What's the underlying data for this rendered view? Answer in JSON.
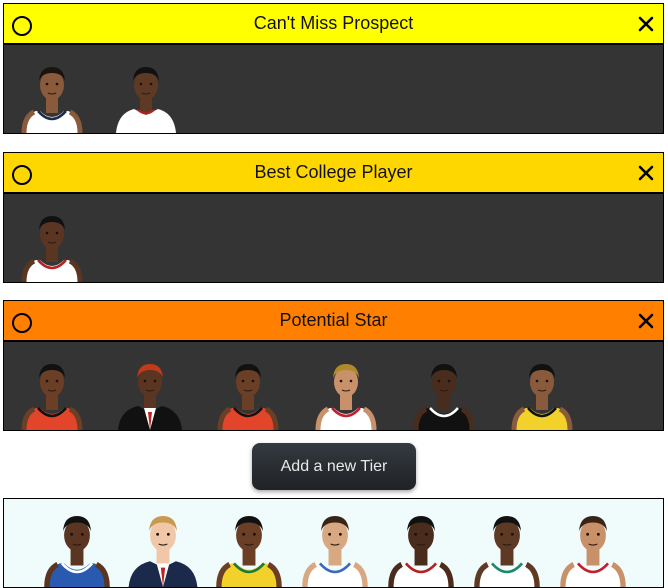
{
  "tiers": [
    {
      "title": "Can't Miss Prospect",
      "color": "#ffff00",
      "players": [
        {
          "skin": "#8a5a3c",
          "hair": "#1a1410",
          "jersey": "#ffffff",
          "trim": "#1b2a4a",
          "style": "tank"
        },
        {
          "skin": "#5e3a24",
          "hair": "#111111",
          "jersey": "#ffffff",
          "trim": "#b52020",
          "style": "tee"
        }
      ]
    },
    {
      "title": "Best College Player",
      "color": "#ffd700",
      "players": [
        {
          "skin": "#5a3522",
          "hair": "#111111",
          "jersey": "#ffffff",
          "trim": "#b52020",
          "style": "tank"
        }
      ]
    },
    {
      "title": "Potential Star",
      "color": "#ff7f00",
      "players": [
        {
          "skin": "#6a3f26",
          "hair": "#111111",
          "jersey": "#e2452a",
          "trim": "#111111",
          "style": "tank"
        },
        {
          "skin": "#5a3522",
          "hair": "#c23a1a",
          "jersey": "#111111",
          "trim": "#ffffff",
          "style": "suit"
        },
        {
          "skin": "#6a3f26",
          "hair": "#111111",
          "jersey": "#e2452a",
          "trim": "#111111",
          "style": "tank"
        },
        {
          "skin": "#c8916a",
          "hair": "#b08a2a",
          "jersey": "#ffffff",
          "trim": "#c02030",
          "style": "tank"
        },
        {
          "skin": "#4a2c1c",
          "hair": "#111111",
          "jersey": "#111111",
          "trim": "#ffffff",
          "style": "tank"
        },
        {
          "skin": "#8a5a3c",
          "hair": "#111111",
          "jersey": "#f2d22a",
          "trim": "#111111",
          "style": "tank"
        }
      ]
    }
  ],
  "add_button_label": "Add a new Tier",
  "pool": [
    {
      "skin": "#5a3522",
      "hair": "#111111",
      "jersey": "#2a5ab0",
      "trim": "#ffffff",
      "style": "tank"
    },
    {
      "skin": "#f0c8a8",
      "hair": "#c89a50",
      "jersey": "#1b2a4a",
      "trim": "#ffffff",
      "style": "suit"
    },
    {
      "skin": "#6a3f26",
      "hair": "#111111",
      "jersey": "#f2d22a",
      "trim": "#1a7a3a",
      "style": "tank"
    },
    {
      "skin": "#d8a882",
      "hair": "#3a2418",
      "jersey": "#ffffff",
      "trim": "#3a6ac0",
      "style": "tank"
    },
    {
      "skin": "#4a2c1c",
      "hair": "#111111",
      "jersey": "#ffffff",
      "trim": "#b52020",
      "style": "tank"
    },
    {
      "skin": "#5e3a24",
      "hair": "#111111",
      "jersey": "#ffffff",
      "trim": "#1a8a6a",
      "style": "tank"
    },
    {
      "skin": "#c8916a",
      "hair": "#3a2418",
      "jersey": "#ffffff",
      "trim": "#c02030",
      "style": "tank"
    }
  ]
}
